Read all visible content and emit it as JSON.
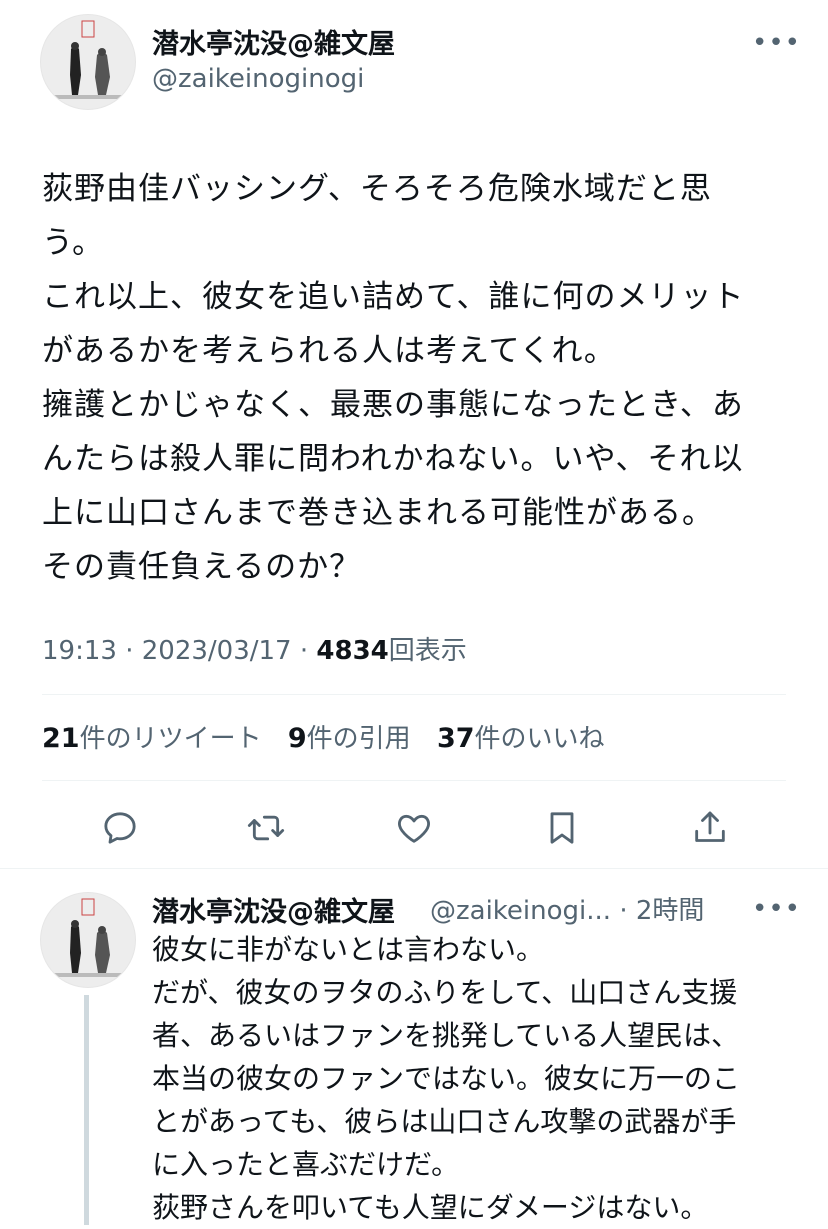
{
  "tweet": {
    "author_name": "潜水亭沈没@雑文屋",
    "author_handle": "@zaikeinoginogi",
    "more_label": "•••",
    "text_lines": [
      "荻野由佳バッシング、そろそろ危険水域だと思",
      "う。",
      "これ以上、彼女を追い詰めて、誰に何のメリット",
      "があるかを考えられる人は考えてくれ。",
      "擁護とかじゃなく、最悪の事態になったとき、あ",
      "んたらは殺人罪に問われかねない。いや、それ以",
      "上に山口さんまで巻き込まれる可能性がある。",
      "その責任負えるのか？"
    ],
    "time": "19:13",
    "dot": "·",
    "date": "2023/03/17",
    "views_count": "4834",
    "views_label": "回表示",
    "stats": {
      "retweets_count": "21",
      "retweets_label": "件のリツイート",
      "quotes_count": "9",
      "quotes_label": "件の引用",
      "likes_count": "37",
      "likes_label": "件のいいね"
    },
    "actions": [
      "reply-icon",
      "retweet-icon",
      "like-icon",
      "bookmark-icon",
      "share-icon"
    ]
  },
  "reply": {
    "author_name": "潜水亭沈没@雑文屋",
    "author_handle": "@zaikeinogi...",
    "dot": "·",
    "time": "2時間",
    "more_label": "•••",
    "text_lines": [
      "彼女に非がないとは言わない。",
      "だが、彼女のヲタのふりをして、山口さん支援",
      "者、あるいはファンを挑発している人望民は、",
      "本当の彼女のファンではない。彼女に万一のこ",
      "とがあっても、彼らは山口さん攻撃の武器が手",
      "に入ったと喜ぶだけだ。",
      "荻野さんを叩いても人望にダメージはない。"
    ]
  },
  "colors": {
    "text_primary": "#0f1419",
    "text_secondary": "#536471",
    "divider": "#eff3f4",
    "thread_line": "#cfd9de"
  }
}
